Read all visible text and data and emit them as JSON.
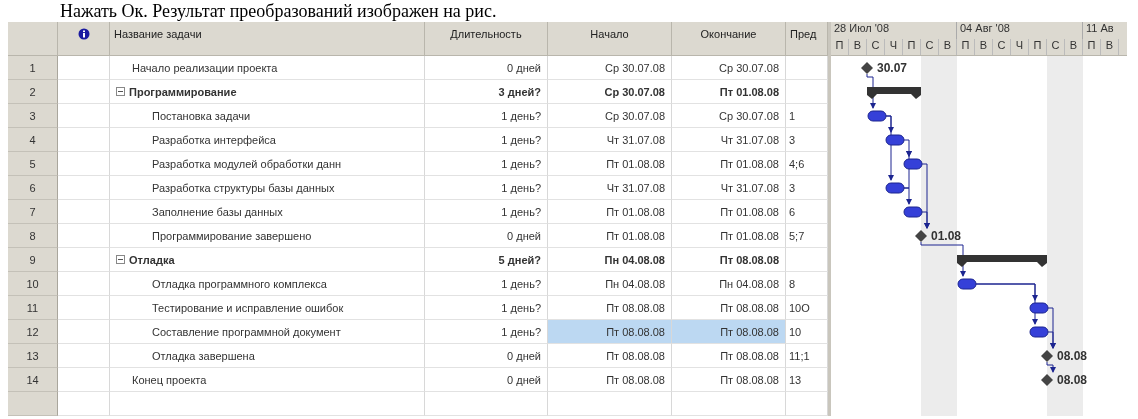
{
  "caption": "Нажать Ок. Результат преобразований изображен на рис.",
  "columns": {
    "name": "Название задачи",
    "duration": "Длительность",
    "start": "Начало",
    "finish": "Окончание",
    "predecessors": "Пред"
  },
  "timescale": {
    "weeks": [
      "28 Июл '08",
      "04 Авг '08",
      "11 Ав"
    ],
    "days": [
      "П",
      "В",
      "С",
      "Ч",
      "П",
      "С",
      "В",
      "П",
      "В",
      "С",
      "Ч",
      "П",
      "С",
      "В",
      "П",
      "В"
    ]
  },
  "tasks": [
    {
      "id": "1",
      "kind": "milestone",
      "name": "Начало реализации проекта",
      "duration": "0 дней",
      "start": "Ср 30.07.08",
      "finish": "Ср 30.07.08",
      "bar_label": "30.07",
      "selected": false
    },
    {
      "id": "2",
      "kind": "summary",
      "expanded": true,
      "name": "Программирование",
      "duration": "3 дней?",
      "start": "Ср 30.07.08",
      "finish": "Пт 01.08.08",
      "selected": false,
      "children": [
        {
          "id": "3",
          "kind": "task",
          "name": "Постановка задачи",
          "duration": "1 день?",
          "start": "Ср 30.07.08",
          "finish": "Ср 30.07.08",
          "predecessors": "1",
          "selected": false
        },
        {
          "id": "4",
          "kind": "task",
          "name": "Разработка интерфейса",
          "duration": "1 день?",
          "start": "Чт 31.07.08",
          "finish": "Чт 31.07.08",
          "predecessors": "3",
          "selected": false
        },
        {
          "id": "5",
          "kind": "task",
          "name": "Разработка модулей обработки данн",
          "duration": "1 день?",
          "start": "Пт 01.08.08",
          "finish": "Пт 01.08.08",
          "predecessors": "4;6",
          "selected": false
        },
        {
          "id": "6",
          "kind": "task",
          "name": "Разработка структуры базы данных",
          "duration": "1 день?",
          "start": "Чт 31.07.08",
          "finish": "Чт 31.07.08",
          "predecessors": "3",
          "selected": false
        },
        {
          "id": "7",
          "kind": "task",
          "name": "Заполнение базы данных",
          "duration": "1 день?",
          "start": "Пт 01.08.08",
          "finish": "Пт 01.08.08",
          "predecessors": "6",
          "selected": false
        },
        {
          "id": "8",
          "kind": "milestone",
          "name": "Программирование завершено",
          "duration": "0 дней",
          "start": "Пт 01.08.08",
          "finish": "Пт 01.08.08",
          "predecessors": "5;7",
          "bar_label": "01.08",
          "selected": false
        }
      ]
    },
    {
      "id": "9",
      "kind": "summary",
      "expanded": true,
      "name": "Отладка",
      "duration": "5 дней?",
      "start": "Пн 04.08.08",
      "finish": "Пт 08.08.08",
      "selected": false,
      "children": [
        {
          "id": "10",
          "kind": "task",
          "name": "Отладка программного комплекса",
          "duration": "1 день?",
          "start": "Пн 04.08.08",
          "finish": "Пн 04.08.08",
          "predecessors": "8",
          "selected": false
        },
        {
          "id": "11",
          "kind": "task",
          "name": "Тестирование и исправление ошибок",
          "duration": "1 день?",
          "start": "Пт 08.08.08",
          "finish": "Пт 08.08.08",
          "predecessors": "10О",
          "selected": false
        },
        {
          "id": "12",
          "kind": "task",
          "name": "Составление программной документ",
          "duration": "1 день?",
          "start": "Пт 08.08.08",
          "finish": "Пт 08.08.08",
          "predecessors": "10",
          "selected": true
        },
        {
          "id": "13",
          "kind": "milestone",
          "name": "Отладка завершена",
          "duration": "0 дней",
          "start": "Пт 08.08.08",
          "finish": "Пт 08.08.08",
          "predecessors": "11;1",
          "bar_label": "08.08",
          "selected": false
        }
      ]
    },
    {
      "id": "14",
      "kind": "milestone",
      "name": "Конец проекта",
      "duration": "0 дней",
      "start": "Пт 08.08.08",
      "finish": "Пт 08.08.08",
      "predecessors": "13",
      "bar_label": "08.08",
      "selected": false
    }
  ]
}
